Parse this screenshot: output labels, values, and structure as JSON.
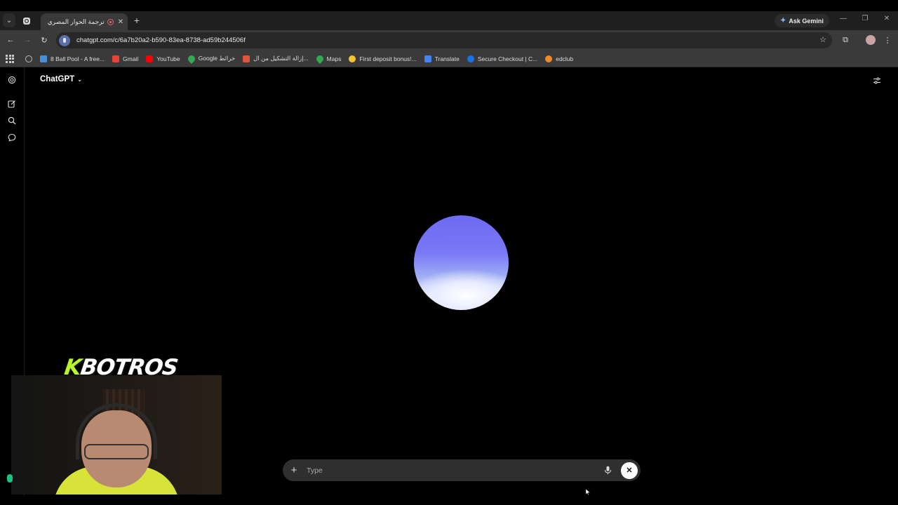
{
  "browser": {
    "tab": {
      "title": "ترجمة الحوار المصري"
    },
    "ask_gemini": "Ask Gemini",
    "url": "chatgpt.com/c/6a7b20a2-b590-83ea-8738-ad59b244506f",
    "bookmarks": [
      {
        "label": "8 Ball Pool - A free...",
        "color": "#4a8fd8"
      },
      {
        "label": "Gmail",
        "color": "#ea4335"
      },
      {
        "label": "YouTube",
        "color": "#ff0000"
      },
      {
        "label": "Google خرائط",
        "color": "#34a853"
      },
      {
        "label": "إزالة التشكيل من ال...",
        "color": "#e2543a"
      },
      {
        "label": "Maps",
        "color": "#34a853"
      },
      {
        "label": "First deposit bonus!...",
        "color": "#f4c430"
      },
      {
        "label": "Translate",
        "color": "#4285f4"
      },
      {
        "label": "Secure Checkout | C...",
        "color": "#1a73e8"
      },
      {
        "label": "edclub",
        "color": "#f08a24"
      }
    ]
  },
  "app": {
    "model_label": "ChatGPT",
    "composer": {
      "placeholder": "Type"
    },
    "orb_colors": {
      "top": "#6e6bf2",
      "bottom": "#ffffff"
    }
  },
  "overlay": {
    "brand_k": "K",
    "brand_rest": "BOTROS"
  }
}
